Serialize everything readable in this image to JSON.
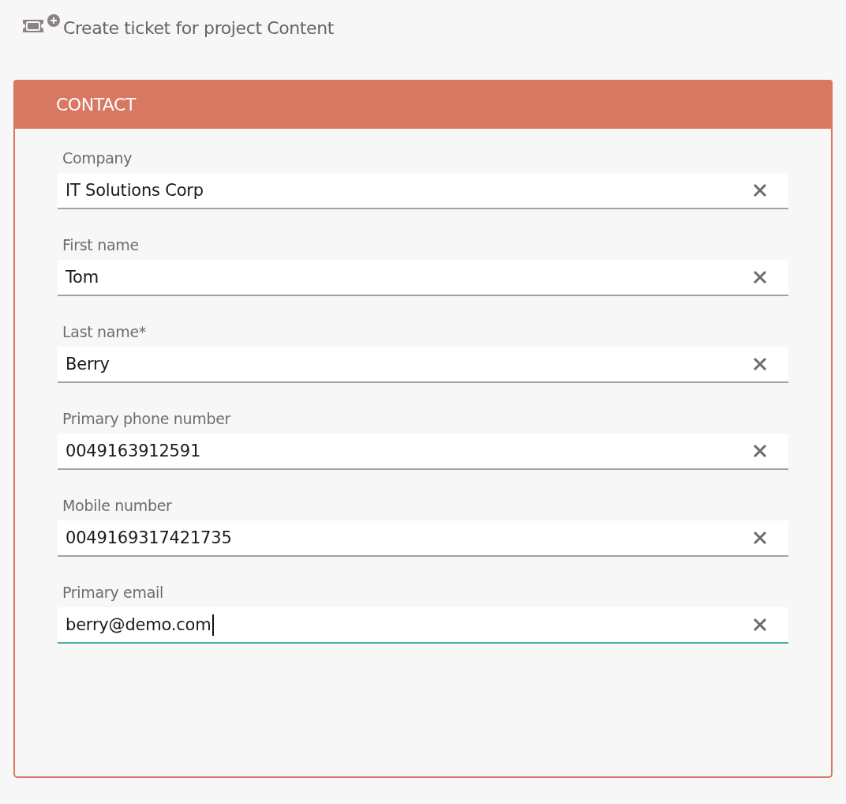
{
  "page_title": "Create ticket for project Content",
  "section": {
    "title": "CONTACT",
    "fields": [
      {
        "label": "Company",
        "value": "IT Solutions Corp",
        "focused": false
      },
      {
        "label": "First name",
        "value": "Tom",
        "focused": false
      },
      {
        "label": "Last name*",
        "value": "Berry",
        "focused": false
      },
      {
        "label": "Primary phone number",
        "value": "0049163912591",
        "focused": false
      },
      {
        "label": "Mobile number",
        "value": "0049169317421735",
        "focused": false
      },
      {
        "label": "Primary email",
        "value": "berry@demo.com",
        "focused": true
      }
    ]
  }
}
